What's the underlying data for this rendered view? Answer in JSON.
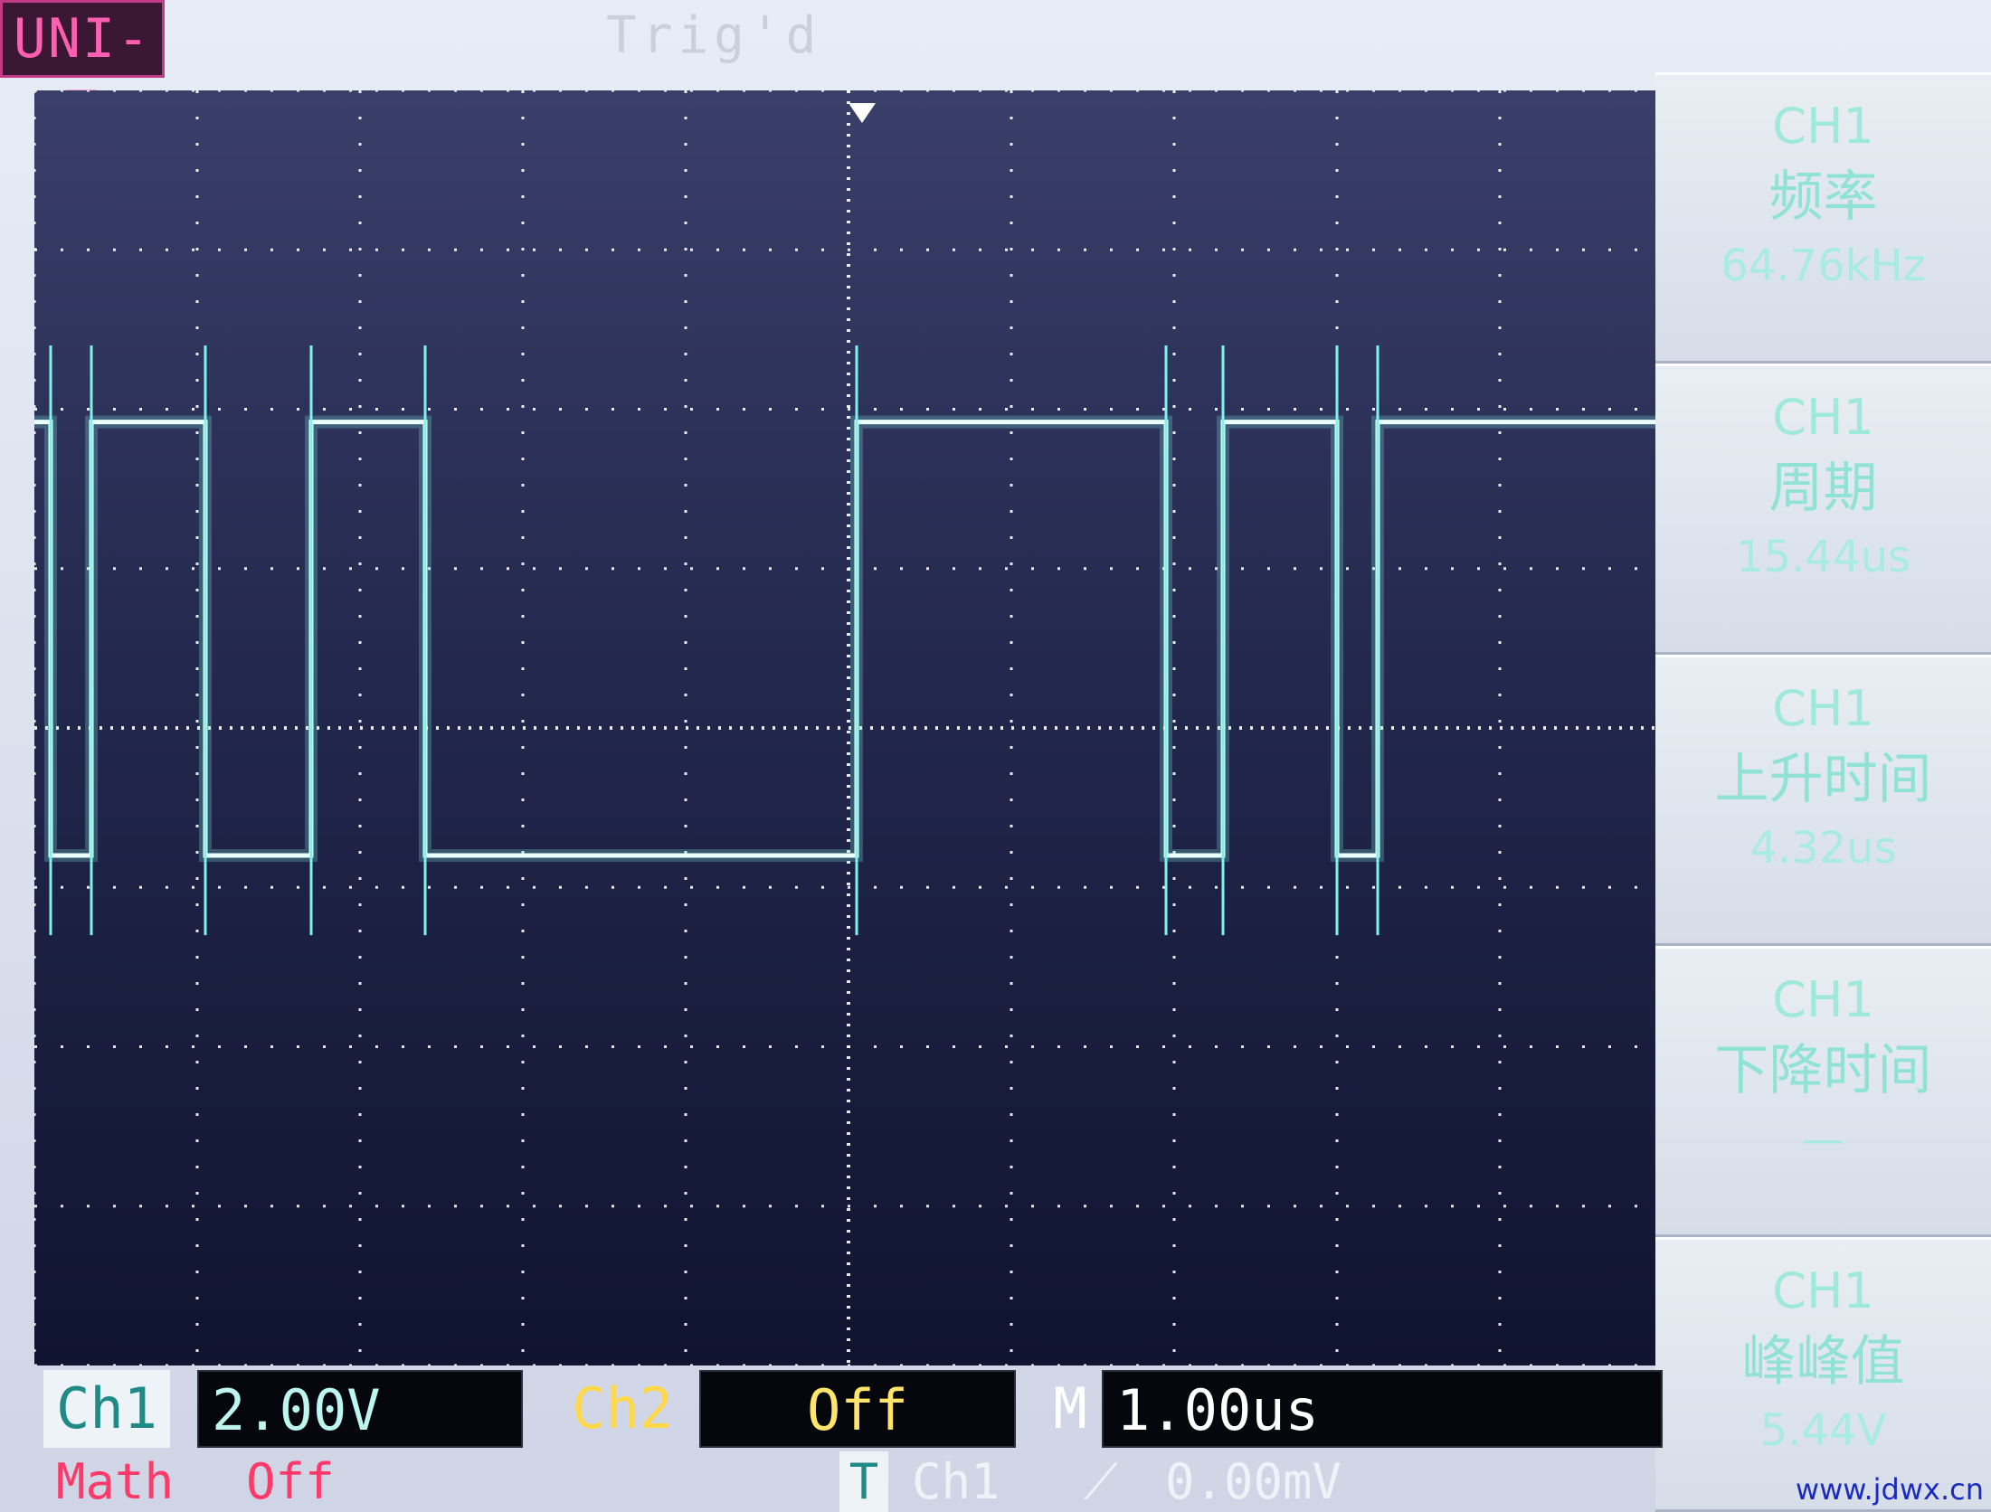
{
  "brand": "UNI-T",
  "trigger_state": "Trig'd",
  "menu": [
    {
      "l1": "CH1",
      "l2": "频率",
      "l3": "64.76kHz"
    },
    {
      "l1": "CH1",
      "l2": "周期",
      "l3": "15.44us"
    },
    {
      "l1": "CH1",
      "l2": "上升时间",
      "l3": "4.32us"
    },
    {
      "l1": "CH1",
      "l2": "下降时间",
      "l3": "—"
    },
    {
      "l1": "CH1",
      "l2": "峰峰值",
      "l3": "5.44V"
    }
  ],
  "status": {
    "ch1_label": "Ch1",
    "ch1_scale": "2.00V",
    "ch2_label": "Ch2",
    "ch2_state": "Off",
    "timebase_marker": "M",
    "timebase": "1.00us"
  },
  "trigger": {
    "math_label": "Math",
    "math_state": "Off",
    "trig_marker": "T",
    "trig_source": "Ch1",
    "slope_symbol": "⟋",
    "trig_level": "0.00mV"
  },
  "watermark": "www.jdwx.cn",
  "colors": {
    "ch1": "#7ff3e8",
    "ch2": "#ffd84a",
    "math": "#ff3a6a",
    "brand": "#ff5fb1",
    "grid": "#ffffff",
    "screen_bg": "#1e2347"
  },
  "icons": {
    "trigger_marker": "down-triangle-icon",
    "slope": "rising-edge-icon"
  },
  "chart_data": {
    "type": "line",
    "title": "",
    "xlabel": "",
    "ylabel": "",
    "x_unit": "us",
    "y_unit": "V",
    "xlim": [
      -5,
      5
    ],
    "ylim": [
      -8,
      8
    ],
    "grid": true,
    "series": [
      {
        "x": [
          -5.0,
          -4.9,
          -4.9,
          -4.65,
          -4.65,
          -3.95,
          -3.95,
          -3.3,
          -3.3,
          -3.05,
          -3.05,
          -2.6,
          -2.6,
          0.05,
          0.05,
          1.95,
          1.95,
          2.3,
          2.3,
          3.0,
          3.0,
          3.25,
          3.25,
          3.3,
          3.3,
          4.95,
          5.0
        ],
        "y": [
          3.84,
          3.84,
          -1.6,
          -1.6,
          3.84,
          3.84,
          -1.6,
          -1.6,
          3.84,
          3.84,
          3.84,
          3.84,
          -1.6,
          -1.6,
          3.84,
          3.84,
          -1.6,
          -1.6,
          3.84,
          3.84,
          -1.6,
          -1.6,
          3.84,
          3.84,
          3.84,
          3.84,
          3.84
        ]
      }
    ]
  }
}
